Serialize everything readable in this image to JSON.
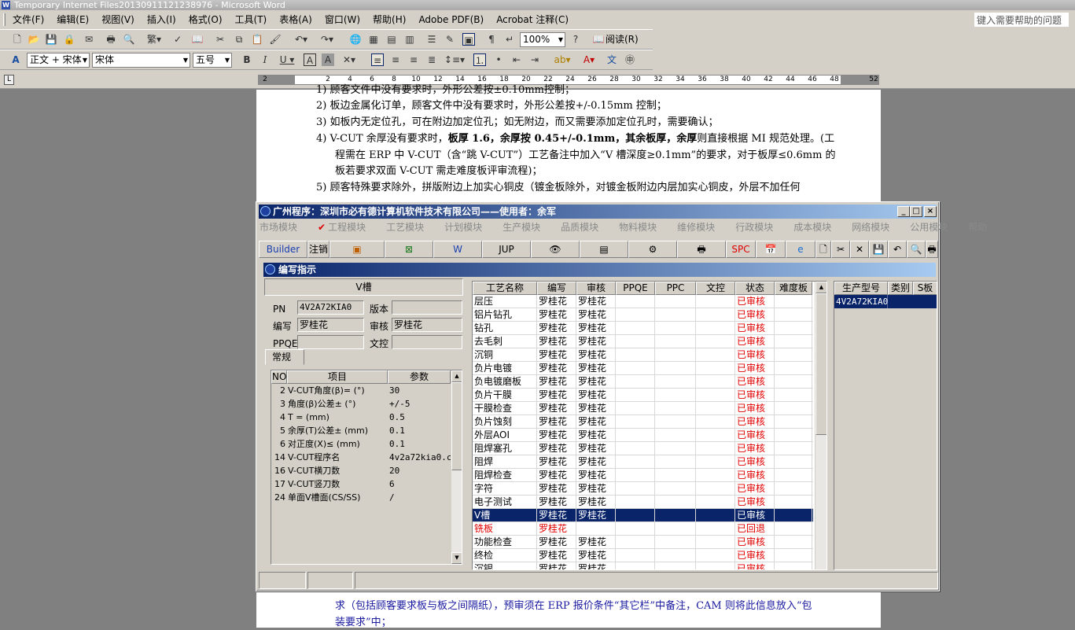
{
  "word": {
    "title": "Temporary Internet Files20130911121238976 - Microsoft Word",
    "menu": [
      "文件(F)",
      "编辑(E)",
      "视图(V)",
      "插入(I)",
      "格式(O)",
      "工具(T)",
      "表格(A)",
      "窗口(W)",
      "帮助(H)",
      "Adobe PDF(B)",
      "Acrobat 注释(C)"
    ],
    "help_placeholder": "键入需要帮助的问题",
    "zoom": "100%",
    "read_label": "阅读(R)",
    "style": "正文 + 宋体",
    "font": "宋体",
    "size": "五号",
    "ruler_marks": [
      "2",
      "2",
      "4",
      "6",
      "8",
      "10",
      "12",
      "14",
      "16",
      "18",
      "20",
      "22",
      "24",
      "26",
      "28",
      "30",
      "32",
      "34",
      "36",
      "38",
      "40",
      "42",
      "44",
      "46",
      "48",
      "52"
    ]
  },
  "document": {
    "line0": "1)  顾客文件中没有要求时，外形公差按±0.10mm控制；",
    "line1": "2)  板边金属化订单，顾客文件中没有要求时，外形公差按+/-0.15mm 控制；",
    "line2": "3)  如板内无定位孔，可在附边加定位孔；如无附边，而又需要添加定位孔时，需要确认；",
    "line3a": "4)  V-CUT 余厚没有要求时，",
    "line3b": "板厚 1.6，余厚按 0.45+/-0.1mm，其余板厚，余厚",
    "line3c": "则直接根据 MI 规范处理。(工",
    "line4": "程需在 ERP 中 V-CUT（含“跳 V-CUT”）工艺备注中加入“V 槽深度≥0.1mm”的要求，对于板厚≤0.6mm 的",
    "line5": "板若要求双面 V-CUT 需走难度板评审流程)；",
    "line6": "5)  顾客特殊要求除外，拼版附边上加实心铜皮（镀金板除外，对镀金板附边内层加实心铜皮，外层不加任何",
    "line7": "求（包括顾客要求板与板之间隔纸），预审须在 ERP 报价条件“其它栏”中备注，CAM 则将此信息放入“包",
    "line8": "装要求”中；"
  },
  "app": {
    "title": "广州程序：深圳市必有德计算机软件技术有限公司——使用者：余军",
    "menu": [
      {
        "label": "市场模块",
        "active": false
      },
      {
        "label": "工程模块",
        "active": true
      },
      {
        "label": "工艺模块",
        "active": false
      },
      {
        "label": "计划模块",
        "active": false
      },
      {
        "label": "生产模块",
        "active": false
      },
      {
        "label": "品质模块",
        "active": true
      },
      {
        "label": "物料模块",
        "active": false
      },
      {
        "label": "维修模块",
        "active": false
      },
      {
        "label": "行政模块",
        "active": false
      },
      {
        "label": "成本模块",
        "active": false
      },
      {
        "label": "网络模块",
        "active": false
      },
      {
        "label": "公用模块",
        "active": true
      },
      {
        "label": "帮助",
        "active": true
      }
    ],
    "toolbar": {
      "builder": "Builder",
      "logout": "注销",
      "jup": "JUP",
      "spc": "SPC"
    },
    "inner_title": "编写指示",
    "form": {
      "header": "V槽",
      "pn_label": "PN",
      "pn": "4V2A72KIA0",
      "version_label": "版本",
      "version": "",
      "writer_label": "编写",
      "writer": "罗桂花",
      "reviewer_label": "审核",
      "reviewer": "罗桂花",
      "ppqe_label": "PPQE",
      "ppqe": "",
      "doc_control_label": "文控",
      "doc_control": "",
      "tab": "常规"
    },
    "params": {
      "headers": {
        "no": "NO",
        "item": "项目",
        "value": "参数"
      },
      "rows": [
        {
          "no": "2",
          "item": "V-CUT角度(β)=  (°)",
          "value": "30"
        },
        {
          "no": "3",
          "item": "角度(β)公差±  (°)",
          "value": "+/-5"
        },
        {
          "no": "4",
          "item": "T =  (mm)",
          "value": "0.5"
        },
        {
          "no": "5",
          "item": "余厚(T)公差±  (mm)",
          "value": "0.1"
        },
        {
          "no": "6",
          "item": "对正度(X)≤  (mm)",
          "value": "0.1"
        },
        {
          "no": "14",
          "item": "V-CUT程序名",
          "value": "4v2a72kia0.cs"
        },
        {
          "no": "16",
          "item": "V-CUT横刀数",
          "value": "20"
        },
        {
          "no": "17",
          "item": "V-CUT竖刀数",
          "value": "6"
        },
        {
          "no": "24",
          "item": "单面V槽面(CS/SS)",
          "value": "/"
        }
      ]
    },
    "processes": {
      "headers": [
        "工艺名称",
        "编写",
        "审核",
        "PPQE",
        "PPC",
        "文控",
        "状态",
        "难度板"
      ],
      "rows": [
        {
          "name": "层压",
          "writer": "罗桂花",
          "reviewer": "罗桂花",
          "status": "已审核"
        },
        {
          "name": "铝片钻孔",
          "writer": "罗桂花",
          "reviewer": "罗桂花",
          "status": "已审核"
        },
        {
          "name": "钻孔",
          "writer": "罗桂花",
          "reviewer": "罗桂花",
          "status": "已审核"
        },
        {
          "name": "去毛刺",
          "writer": "罗桂花",
          "reviewer": "罗桂花",
          "status": "已审核"
        },
        {
          "name": "沉铜",
          "writer": "罗桂花",
          "reviewer": "罗桂花",
          "status": "已审核"
        },
        {
          "name": "负片电镀",
          "writer": "罗桂花",
          "reviewer": "罗桂花",
          "status": "已审核"
        },
        {
          "name": "负电镀磨板",
          "writer": "罗桂花",
          "reviewer": "罗桂花",
          "status": "已审核"
        },
        {
          "name": "负片干膜",
          "writer": "罗桂花",
          "reviewer": "罗桂花",
          "status": "已审核"
        },
        {
          "name": "干膜检查",
          "writer": "罗桂花",
          "reviewer": "罗桂花",
          "status": "已审核"
        },
        {
          "name": "负片蚀刻",
          "writer": "罗桂花",
          "reviewer": "罗桂花",
          "status": "已审核"
        },
        {
          "name": "外层AOI",
          "writer": "罗桂花",
          "reviewer": "罗桂花",
          "status": "已审核"
        },
        {
          "name": "阻焊塞孔",
          "writer": "罗桂花",
          "reviewer": "罗桂花",
          "status": "已审核"
        },
        {
          "name": "阻焊",
          "writer": "罗桂花",
          "reviewer": "罗桂花",
          "status": "已审核"
        },
        {
          "name": "阻焊检查",
          "writer": "罗桂花",
          "reviewer": "罗桂花",
          "status": "已审核"
        },
        {
          "name": "字符",
          "writer": "罗桂花",
          "reviewer": "罗桂花",
          "status": "已审核"
        },
        {
          "name": "电子测试",
          "writer": "罗桂花",
          "reviewer": "罗桂花",
          "status": "已审核"
        },
        {
          "name": "V槽",
          "writer": "罗桂花",
          "reviewer": "罗桂花",
          "status": "已审核"
        },
        {
          "name": "铣板",
          "writer": "罗桂花",
          "reviewer": "",
          "status": "已回退"
        },
        {
          "name": "功能检查",
          "writer": "罗桂花",
          "reviewer": "罗桂花",
          "status": "已审核"
        },
        {
          "name": "终检",
          "writer": "罗桂花",
          "reviewer": "罗桂花",
          "status": "已审核"
        },
        {
          "name": "沉银",
          "writer": "罗桂花",
          "reviewer": "罗桂花",
          "status": "已审核"
        }
      ]
    },
    "models": {
      "headers": [
        "生产型号",
        "类别",
        "S板"
      ],
      "rows": [
        {
          "model": "4V2A72KIA0",
          "type": "",
          "s": ""
        }
      ]
    }
  }
}
